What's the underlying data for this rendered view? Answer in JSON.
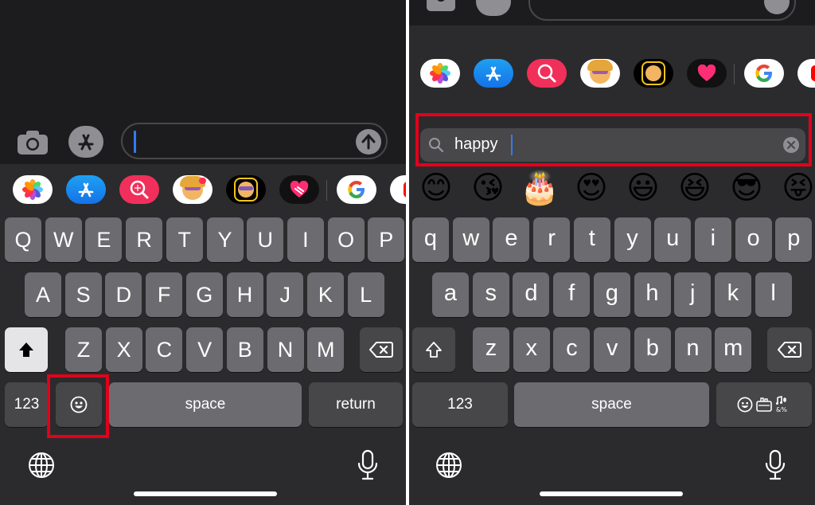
{
  "left": {
    "keyboard_rows": [
      [
        "Q",
        "W",
        "E",
        "R",
        "T",
        "Y",
        "U",
        "I",
        "O",
        "P"
      ],
      [
        "A",
        "S",
        "D",
        "F",
        "G",
        "H",
        "J",
        "K",
        "L"
      ],
      [
        "Z",
        "X",
        "C",
        "V",
        "B",
        "N",
        "M"
      ]
    ],
    "numbers_label": "123",
    "space_label": "space",
    "return_label": "return",
    "input_value": ""
  },
  "right": {
    "keyboard_rows": [
      [
        "q",
        "w",
        "e",
        "r",
        "t",
        "y",
        "u",
        "i",
        "o",
        "p"
      ],
      [
        "a",
        "s",
        "d",
        "f",
        "g",
        "h",
        "j",
        "k",
        "l"
      ],
      [
        "z",
        "x",
        "c",
        "v",
        "b",
        "n",
        "m"
      ]
    ],
    "numbers_label": "123",
    "space_label": "space",
    "search_value": "happy",
    "emoji_results": [
      "😊",
      "😘",
      "🎂",
      "😍",
      "😃",
      "😆",
      "😎",
      "😝"
    ]
  },
  "app_strip_icons": [
    "photos-icon",
    "app-store-icon",
    "image-search-icon",
    "memoji-stickers-icon",
    "animoji-icon",
    "digital-touch-icon",
    "google-icon",
    "youtube-icon"
  ],
  "colors": {
    "highlight": "#e3001b",
    "key": "#6c6c70",
    "function_key": "#474749",
    "keyboard_bg": "#2b2b2d"
  }
}
